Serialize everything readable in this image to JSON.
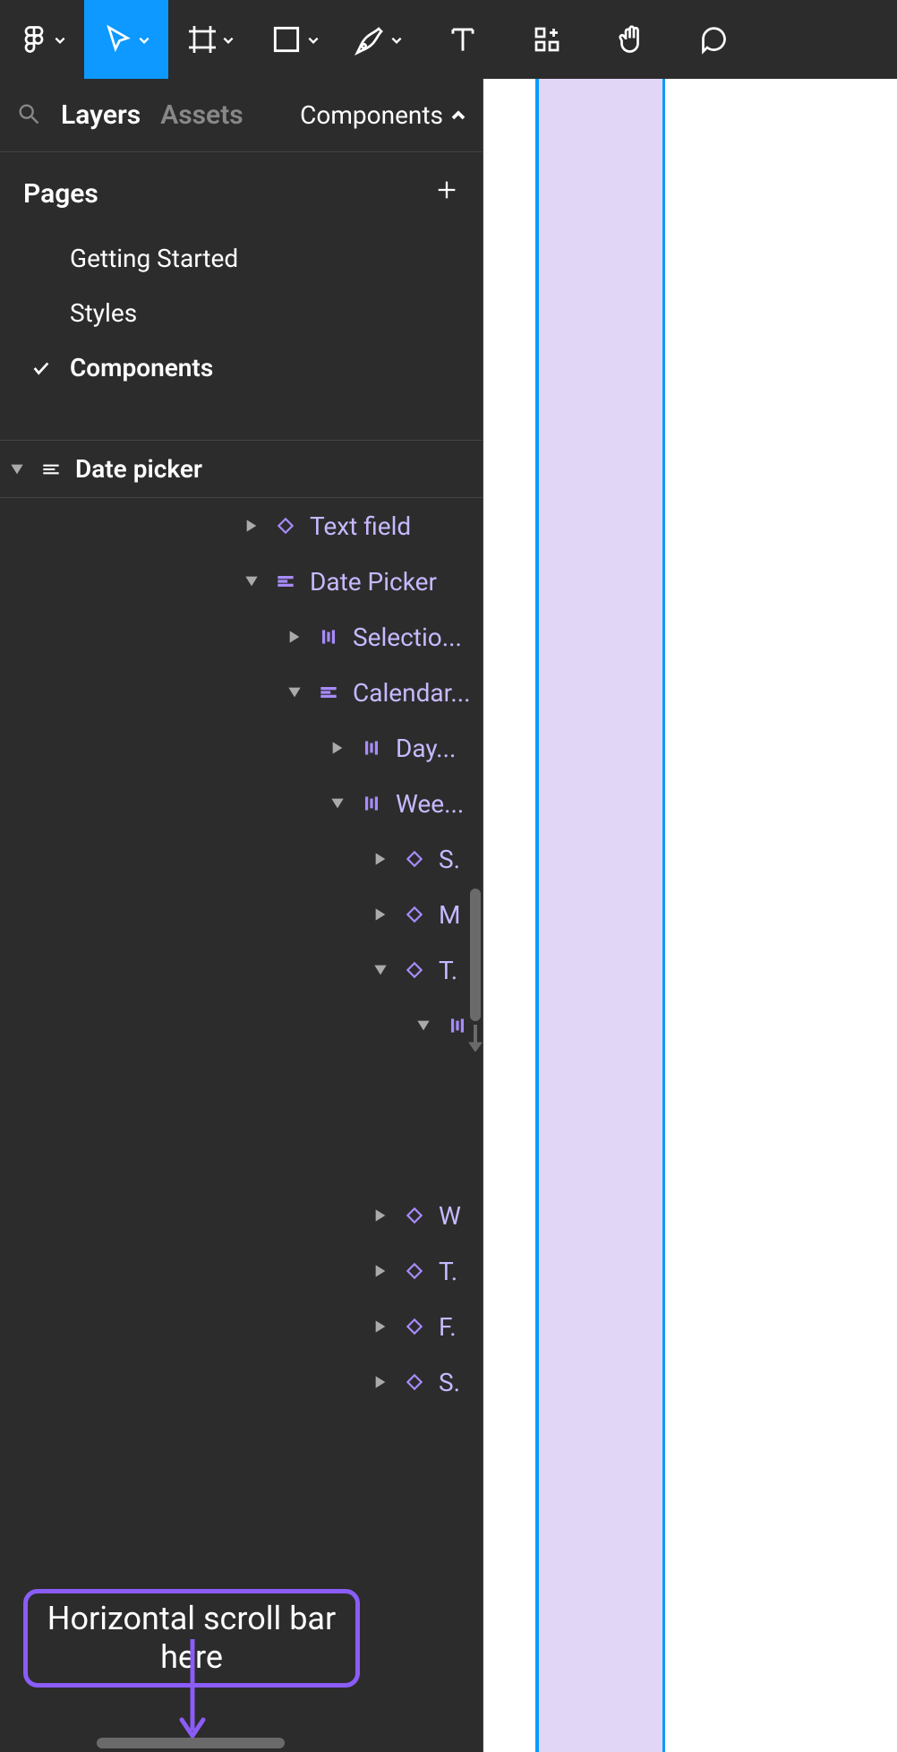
{
  "toolbar": {
    "tools": [
      "figma-menu",
      "move",
      "frame",
      "rectangle",
      "pen",
      "text",
      "plugins",
      "hand",
      "comment"
    ]
  },
  "panel": {
    "tabs": {
      "layers": "Layers",
      "assets": "Assets"
    },
    "page_selector_label": "Components",
    "pages_header": "Pages",
    "pages": [
      {
        "name": "Getting Started",
        "active": false
      },
      {
        "name": "Styles",
        "active": false
      },
      {
        "name": "Components",
        "active": true
      }
    ]
  },
  "layers_root": {
    "name": "Date picker"
  },
  "layers": [
    {
      "depth": 1,
      "expanded": false,
      "icon": "diamond",
      "label": "Text field"
    },
    {
      "depth": 1,
      "expanded": true,
      "icon": "autolayout-h",
      "label": "Date Picker"
    },
    {
      "depth": 2,
      "expanded": false,
      "icon": "bars-v",
      "label": "Selectio..."
    },
    {
      "depth": 2,
      "expanded": true,
      "icon": "autolayout-h",
      "label": "Calendar..."
    },
    {
      "depth": 3,
      "expanded": false,
      "icon": "bars-v",
      "label": "Day..."
    },
    {
      "depth": 3,
      "expanded": true,
      "icon": "bars-v",
      "label": "Wee..."
    },
    {
      "depth": 4,
      "expanded": false,
      "icon": "diamond",
      "label": "S."
    },
    {
      "depth": 4,
      "expanded": false,
      "icon": "diamond",
      "label": "M"
    },
    {
      "depth": 4,
      "expanded": true,
      "icon": "diamond",
      "label": "T."
    },
    {
      "depth": 5,
      "expanded": true,
      "icon": "bars-v",
      "label": ""
    },
    {
      "depth": 4,
      "expanded": false,
      "icon": "diamond",
      "label": "W"
    },
    {
      "depth": 4,
      "expanded": false,
      "icon": "diamond",
      "label": "T."
    },
    {
      "depth": 4,
      "expanded": false,
      "icon": "diamond",
      "label": "F."
    },
    {
      "depth": 4,
      "expanded": false,
      "icon": "diamond",
      "label": "S."
    }
  ],
  "annotation": {
    "text": "Horizontal scroll bar here"
  },
  "colors": {
    "accent": "#0d99ff",
    "component": "#a78bfa",
    "lavender": "#e1d6f5",
    "annotation": "#8b5cf6"
  }
}
